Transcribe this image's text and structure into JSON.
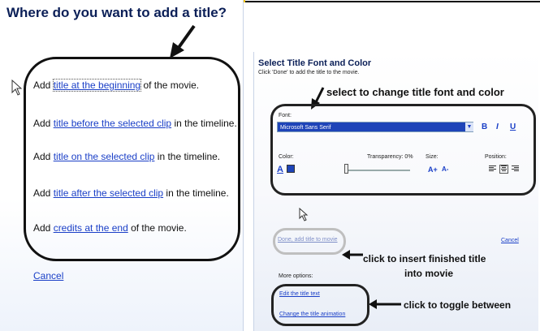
{
  "left": {
    "title": "Where do you want to add a title?",
    "options": [
      {
        "prefix": "Add ",
        "link": "title at the beginning",
        "suffix": " of the movie."
      },
      {
        "prefix": "Add ",
        "link": "title before the selected clip",
        "suffix": " in the timeline."
      },
      {
        "prefix": "Add ",
        "link": "title on the selected clip",
        "suffix": " in the timeline."
      },
      {
        "prefix": "Add ",
        "link": "title after the selected clip",
        "suffix": " in the timeline."
      },
      {
        "prefix": "Add ",
        "link": "credits at the end",
        "suffix": " of the movie."
      }
    ],
    "cancel": "Cancel"
  },
  "right": {
    "title": "Select Title Font and Color",
    "subtitle": "Click 'Done' to add the title to the movie.",
    "font_label": "Font:",
    "font_value": "Microsoft Sans Serif",
    "bold": "B",
    "italic": "I",
    "underline": "U",
    "color_label": "Color:",
    "transparency_label": "Transparency:  0%",
    "size_label": "Size:",
    "position_label": "Position:",
    "size_up": "A+",
    "size_down": "A-",
    "done": "Done, add title to movie",
    "cancel": "Cancel",
    "more_options": "More options:",
    "edit_title": "Edit the title text",
    "change_animation": "Change the title animation",
    "font_color": "#1e44b8"
  },
  "annotations": {
    "font_note": "select to change title font and color",
    "insert_note_1": "click to insert finished title",
    "insert_note_2": "into movie",
    "toggle_note": "click to toggle between"
  }
}
